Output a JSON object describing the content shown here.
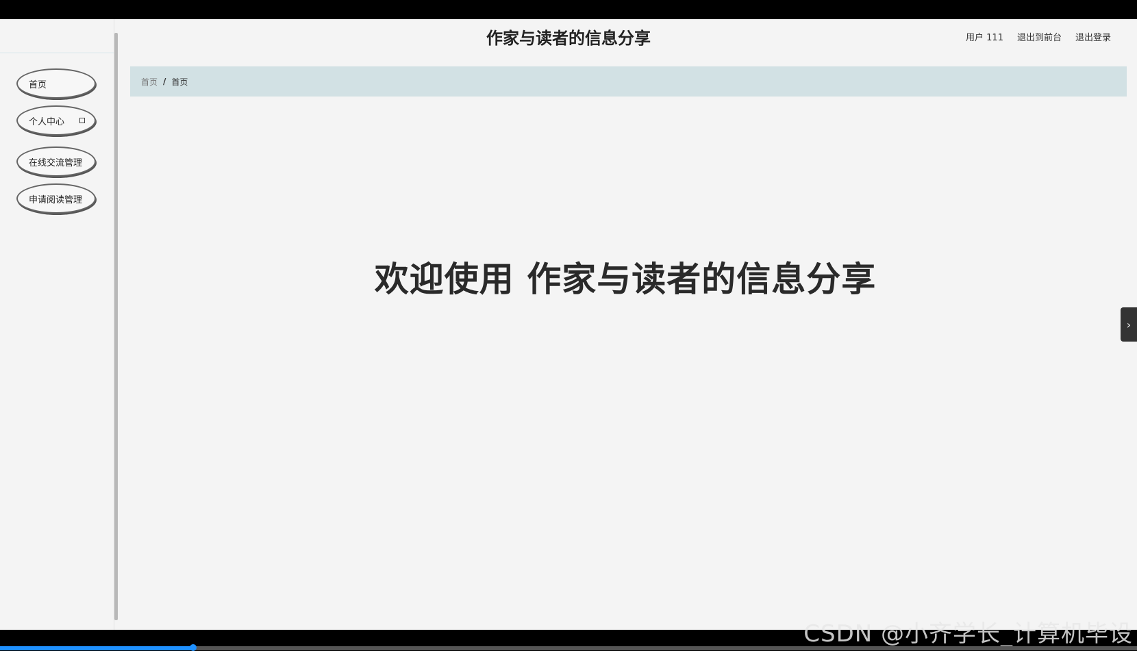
{
  "header": {
    "title": "作家与读者的信息分享",
    "user_label": "用户 111",
    "to_frontend": "退出到前台",
    "logout": "退出登录"
  },
  "sidebar": {
    "items": [
      {
        "label": "首页",
        "has_submenu": false
      },
      {
        "label": "个人中心",
        "has_submenu": true
      },
      {
        "label": "在线交流管理",
        "has_submenu": false
      },
      {
        "label": "申请阅读管理",
        "has_submenu": false
      }
    ]
  },
  "breadcrumb": {
    "items": [
      "首页",
      "首页"
    ],
    "separator": "/"
  },
  "main": {
    "welcome": "欢迎使用 作家与读者的信息分享"
  },
  "side_toggle": {
    "icon": "chevron-right-icon",
    "glyph": "›"
  },
  "video_player": {
    "progress_fraction": 0.17,
    "watermark": "CSDN @小齐学长_计算机毕设"
  },
  "colors": {
    "breadcrumb_bg": "#d2e1e4",
    "progress": "#1e90ff"
  }
}
